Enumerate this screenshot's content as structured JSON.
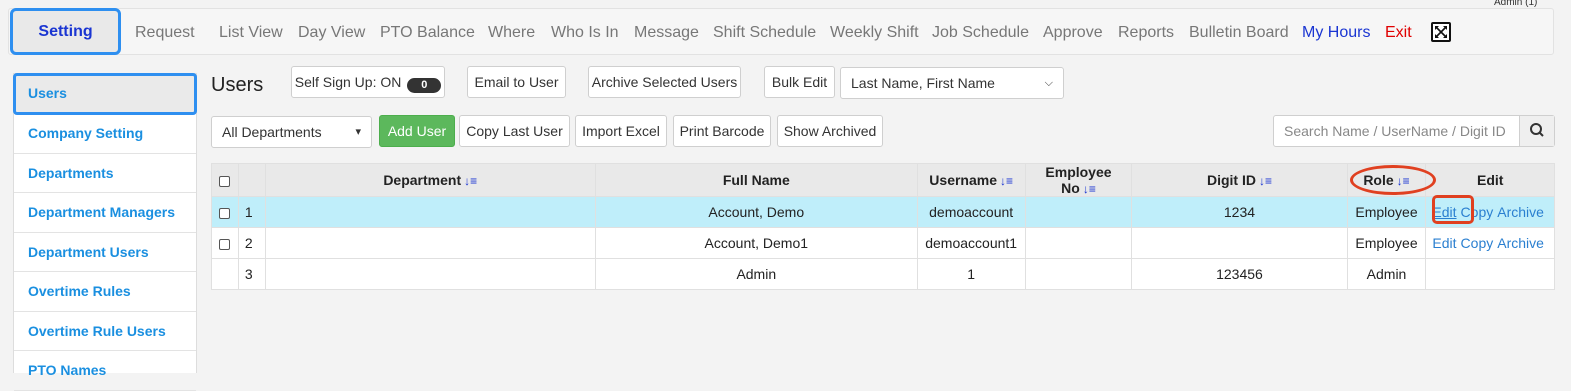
{
  "header": {
    "admin_label": "Admin (1)",
    "nav": [
      {
        "label": "Setting"
      },
      {
        "label": "Request"
      },
      {
        "label": "List View"
      },
      {
        "label": "Day View"
      },
      {
        "label": "PTO Balance"
      },
      {
        "label": "Where"
      },
      {
        "label": "Who Is In"
      },
      {
        "label": "Message"
      },
      {
        "label": "Shift Schedule"
      },
      {
        "label": "Weekly Shift"
      },
      {
        "label": "Job Schedule"
      },
      {
        "label": "Approve"
      },
      {
        "label": "Reports"
      },
      {
        "label": "Bulletin Board"
      },
      {
        "label": "My Hours"
      },
      {
        "label": "Exit"
      }
    ],
    "fullscreen_icon": "fullscreen-icon"
  },
  "sidebar": {
    "items": [
      {
        "label": "Users"
      },
      {
        "label": "Company Setting"
      },
      {
        "label": "Departments"
      },
      {
        "label": "Department Managers"
      },
      {
        "label": "Department Users"
      },
      {
        "label": "Overtime Rules"
      },
      {
        "label": "Overtime Rule Users"
      },
      {
        "label": "PTO Names"
      }
    ]
  },
  "main": {
    "title": "Users",
    "self_signup_label": "Self Sign Up: ON",
    "self_signup_count": "0",
    "email_to_user": "Email to User",
    "archive_selected": "Archive Selected Users",
    "bulk_edit": "Bulk Edit",
    "name_order_select": "Last Name, First Name",
    "department_select": "All Departments",
    "add_user": "Add User",
    "copy_last_user": "Copy Last User",
    "import_excel": "Import Excel",
    "print_barcode": "Print Barcode",
    "show_archived": "Show Archived",
    "search_placeholder": "Search Name / UserName / Digit ID"
  },
  "table": {
    "headers": {
      "department": "Department",
      "full_name": "Full Name",
      "username": "Username",
      "employee_no": "Employee No",
      "digit_id": "Digit ID",
      "role": "Role",
      "edit": "Edit"
    },
    "rows": [
      {
        "num": "1",
        "department": "",
        "full_name": "Account, Demo",
        "username": "demoaccount",
        "employee_no": "",
        "digit_id": "1234",
        "role": "Employee",
        "edit": "Edit",
        "copy": "Copy",
        "archive": "Archive"
      },
      {
        "num": "2",
        "department": "",
        "full_name": "Account, Demo1",
        "username": "demoaccount1",
        "employee_no": "",
        "digit_id": "",
        "role": "Employee",
        "edit": "Edit",
        "copy": "Copy",
        "archive": "Archive"
      },
      {
        "num": "3",
        "department": "",
        "full_name": "Admin",
        "username": "1",
        "employee_no": "",
        "digit_id": "123456",
        "role": "Admin"
      }
    ]
  },
  "colors": {
    "accent_blue": "#2e8ff0",
    "link_blue": "#1a8fe0",
    "highlight_row": "#bfeefa",
    "add_green": "#5cb85c",
    "annotation_red": "#e04020"
  }
}
